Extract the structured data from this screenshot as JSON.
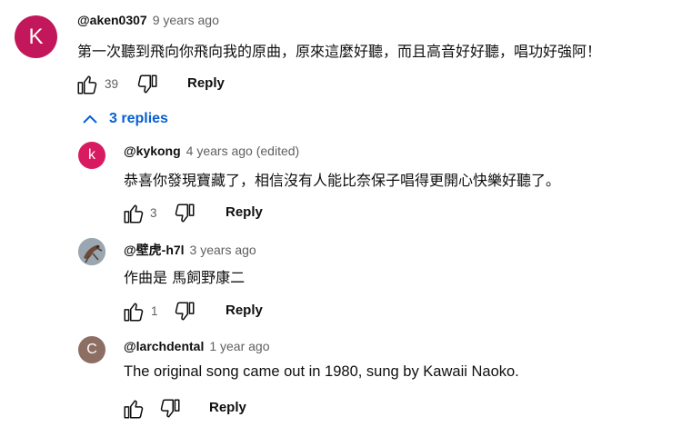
{
  "thread": {
    "author": "@aken0307",
    "time": "9 years ago",
    "avatar_letter": "K",
    "avatar_color": "#c2185b",
    "text": "第一次聽到飛向你飛向我的原曲，原來這麼好聽，而且高音好好聽，唱功好強阿！",
    "likes": "39",
    "reply_label": "Reply",
    "replies_toggle_label": "3 replies",
    "toggle_icon": "chevron-up-icon"
  },
  "replies": [
    {
      "author": "@kykong",
      "time": "4 years ago (edited)",
      "avatar_letter": "k",
      "avatar_color": "#d81b60",
      "text": "恭喜你發現寶藏了，相信沒有人能比奈保子唱得更開心快樂好聽了。",
      "likes": "3",
      "reply_label": "Reply"
    },
    {
      "author": "@壁虎-h7l",
      "time": "3 years ago",
      "avatar_icon": "gecko-avatar-image",
      "text": "作曲是 馬飼野康二",
      "likes": "1",
      "reply_label": "Reply"
    },
    {
      "author": "@larchdental",
      "time": "1 year ago",
      "avatar_letter": "C",
      "avatar_color": "#8d6e63",
      "text": "The original song came out in 1980, sung by Kawaii Naoko.",
      "likes": "",
      "reply_label": "Reply"
    }
  ]
}
